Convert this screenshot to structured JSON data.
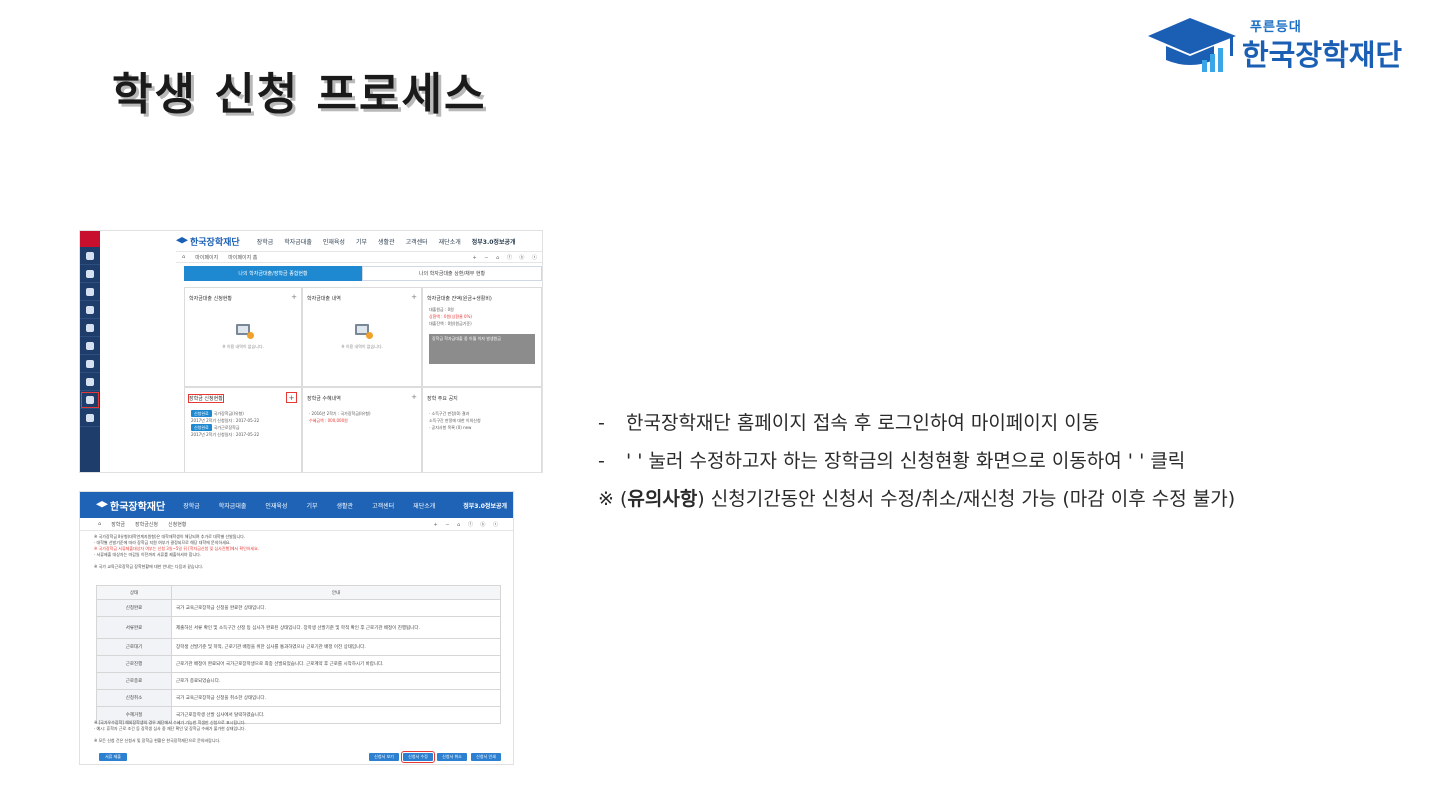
{
  "slide": {
    "title": "학생 신청 프로세스",
    "logo": {
      "tagline": "푸른등대",
      "name": "한국장학재단"
    },
    "description": {
      "line1_dash": "-",
      "line1": "한국장학재단 홈페이지 접속 후 로그인하여 마이페이지 이동",
      "line2_dash": "-",
      "line2": "' ' 눌러 수정하고자 하는 장학금의 신청현황 화면으로 이동하여 ' ' 클릭",
      "line3_prefix": "※ (",
      "line3_bold": "유의사항",
      "line3_suffix": ") 신청기간동안 신청서 수정/취소/재신청 가능 (마감 이후 수정 불가)"
    }
  },
  "shot1": {
    "logo": "한국장학재단",
    "nav": [
      "장학금",
      "학자금대출",
      "인재육성",
      "기부",
      "생활관",
      "고객센터",
      "재단소개"
    ],
    "nav_right": "정부3.0정보공개",
    "crumbs": [
      "마이페이지",
      "마이페이지 홈"
    ],
    "controls": "+ − ⌂ ⓕ ⓑ ⓣ",
    "tabs": [
      "나의 학자금대출/장학금 종합현황",
      "나의 학자금대출 상환/채무 현황"
    ],
    "cards": {
      "c1_title": "학자금대출 신청현황",
      "c2_title": "학자금대출 내역",
      "c3_title": "학자금대출 잔액(원금+생활비)",
      "c4_title": "장학금 신청현황",
      "c5_title": "장학금 수혜내역",
      "c6_title": "장학 주요 공지",
      "empty": "※ 이용 내역이 없습니다.",
      "plus": "+"
    },
    "c3_lines": [
      "대출원금 : 0원",
      "상환액 : 0원(상환율 0%)",
      "대출잔액 : 0원(원금기준)"
    ],
    "c3_box": "장학금 학자금대출 중 이월 이자 발생원금",
    "c4_badge1": "신청완료",
    "c4_item1": "국가장학금(Ⅰ유형)",
    "c4_item1_sub": "2017년 2학기 신청일자 : 2017-05-22",
    "c4_badge2": "신청완료",
    "c4_item2": "국가근로장학금",
    "c4_item2_sub": "2017년 2학기 신청일자 : 2017-05-22",
    "c5_lines": [
      "· 2016년 2학기 : 국가장학금(Ⅰ유형)",
      "  수혜금액 : 000,000원"
    ],
    "c6_lines": [
      "· 소득구간 판정(0) 결과",
      "  소득구간 판정에 대한 이의신청",
      "· 공지사항 목록 (0) new"
    ]
  },
  "shot2": {
    "logo": "한국장학재단",
    "nav": [
      "장학금",
      "학자금대출",
      "인재육성",
      "기부",
      "생활관",
      "고객센터",
      "재단소개"
    ],
    "nav_right": "정부3.0정보공개",
    "crumbs": [
      "장학금",
      "장학금신청",
      "신청현황"
    ],
    "controls": "+ − ⌂ ⓕ ⓑ ⓣ",
    "notes": [
      "※ 국가장학금 Ⅱ유형(대학연계지원형)은 대학재학생이 해당되며 추가로 대학별 선발됩니다.",
      "  · 대학별 선발기준에 따라 장학금 지원 여부가 결정되므로 해당 대학에 문의하세요.",
      "※ 국가장학금 서류제출대상자 여부는 신청 3일~5일 뒤 [학자금신청 및 심사진행]에서 확인하세요.",
      "  · 서류제출 대상자는 마감일 이전까지 서류를 제출하셔야 합니다.",
      "",
      "※ 국가 교육근로장학금 장학현황에 대한 안내는 다음과 같습니다."
    ],
    "table_header": [
      "상태",
      "안내"
    ],
    "table_rows": [
      {
        "status": "신청완료",
        "desc": "국가 교육근로장학금 신청을 완료한 상태입니다."
      },
      {
        "status": "서류완료",
        "desc": "제출하신 서류 확인 및 소득구간 산정 등 심사가 완료된 상태입니다. 장학생 선발기준 및 학적 확인 후 근로기관 배정이 진행됩니다."
      },
      {
        "status": "근로대기",
        "desc": "장학생 선발기준 및 학적, 근로기관 배정을 위한 심사를 통과하였으나 근로기관 배정 이전 상태입니다."
      },
      {
        "status": "근로진행",
        "desc": "근로기관 배정이 완료되어 국가근로장학생으로 최종 선발되었습니다. 근로계약 후 근로를 시작하시기 바랍니다."
      },
      {
        "status": "근로종료",
        "desc": "근로가 종료되었습니다."
      },
      {
        "status": "신청취소",
        "desc": "국가 교육근로장학금 신청을 취소한 상태입니다."
      },
      {
        "status": "수혜거절",
        "desc": "국가근로장학생 선발 심사에서 탈락하였습니다."
      }
    ],
    "foot_notes": [
      "※ [국가우수장학] 해외장학생의 경우 재단에서 수혜가 가능한 학생만 신청으로 표시됩니다.",
      "  · 예시: 휴학자 근로 조건 등 장학생 심사 중 재단 확인 및 장학금 수혜가 불가한 상태입니다.",
      "",
      "※ 모든 신청 건은 신청서 및 장학금 현황은 한국장학재단으로 문의바랍니다."
    ],
    "buttons": [
      "서류 제출",
      "신청서 보기",
      "신청서 수정",
      "신청서 취소",
      "신청서 인쇄"
    ]
  }
}
